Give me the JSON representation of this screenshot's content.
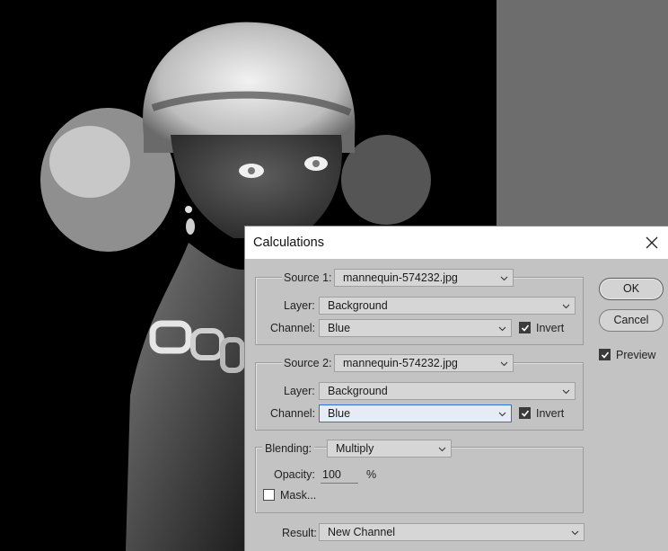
{
  "dialog": {
    "title": "Calculations",
    "source1": {
      "label": "Source 1:",
      "file": "mannequin-574232.jpg",
      "layer_label": "Layer:",
      "layer": "Background",
      "channel_label": "Channel:",
      "channel": "Blue",
      "invert_label": "Invert",
      "invert_checked": true
    },
    "source2": {
      "label": "Source 2:",
      "file": "mannequin-574232.jpg",
      "layer_label": "Layer:",
      "layer": "Background",
      "channel_label": "Channel:",
      "channel": "Blue",
      "invert_label": "Invert",
      "invert_checked": true
    },
    "blending": {
      "label": "Blending:",
      "mode": "Multiply",
      "opacity_label": "Opacity:",
      "opacity_value": "100",
      "opacity_unit": "%",
      "mask_label": "Mask...",
      "mask_checked": false
    },
    "result": {
      "label": "Result:",
      "value": "New Channel"
    },
    "buttons": {
      "ok": "OK",
      "cancel": "Cancel"
    },
    "preview": {
      "label": "Preview",
      "checked": true
    }
  },
  "colors": {
    "dialog_bg": "#c3c3c3",
    "pasteboard": "#6d6d6d",
    "focus_accent": "#2f6fd6"
  }
}
